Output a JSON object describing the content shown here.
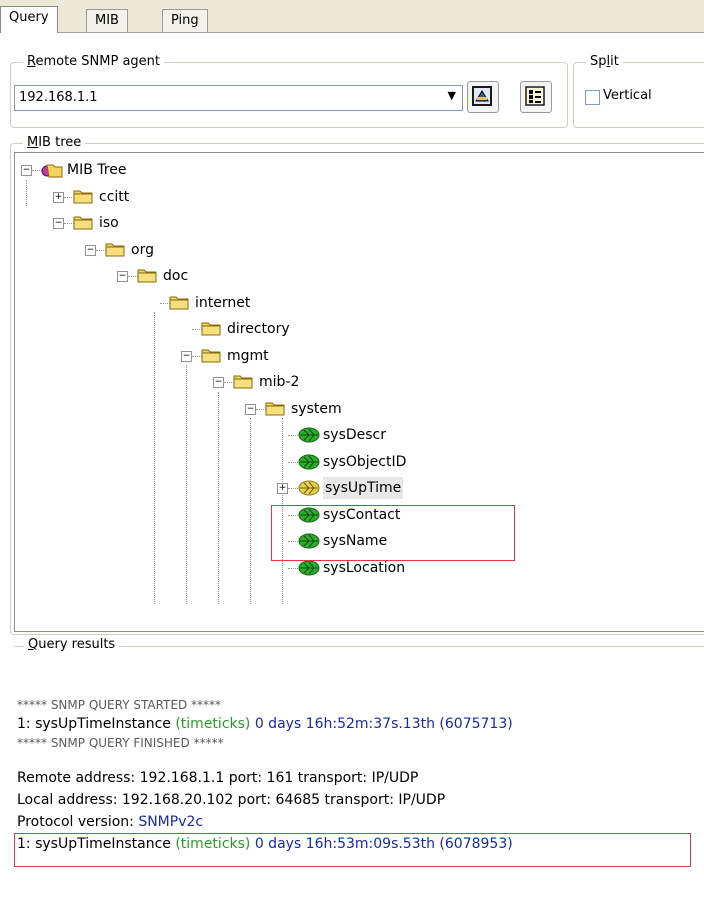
{
  "tabs": [
    "Query",
    "MIB",
    "Ping"
  ],
  "agent_group": {
    "legend_first": "R",
    "legend_rest": "emote SNMP agent"
  },
  "agent_input": {
    "value": "192.168.1.1",
    "arrow": "▼"
  },
  "split_group": {
    "legend_first": "Sp",
    "legend_u": "l",
    "legend_rest": "it",
    "checkbox_label": "Vertical"
  },
  "mib_group": {
    "legend_first": "M",
    "legend_rest": "IB tree"
  },
  "tree": [
    {
      "label": "MIB Tree",
      "icon": "mib-tree-icon",
      "expander": "−"
    },
    {
      "label": "ccitt",
      "icon": "folder-icon",
      "expander": "+"
    },
    {
      "label": "iso",
      "icon": "folder-icon",
      "expander": "−"
    },
    {
      "label": "org",
      "icon": "folder-icon",
      "expander": "−"
    },
    {
      "label": "doc",
      "icon": "folder-icon",
      "expander": "−"
    },
    {
      "label": "internet",
      "icon": "folder-icon",
      "expander": ""
    },
    {
      "label": "directory",
      "icon": "folder-icon",
      "expander": ""
    },
    {
      "label": "mgmt",
      "icon": "folder-icon",
      "expander": "−"
    },
    {
      "label": "mib-2",
      "icon": "folder-icon",
      "expander": "−"
    },
    {
      "label": "system",
      "icon": "folder-icon",
      "expander": "−"
    },
    {
      "label": "sysDescr",
      "icon": "leaf-icon",
      "expander": ""
    },
    {
      "label": "sysObjectID",
      "icon": "leaf-icon",
      "expander": ""
    },
    {
      "label": "sysUpTime",
      "icon": "leaf-selected-icon",
      "expander": "+"
    },
    {
      "label": "sysContact",
      "icon": "leaf-icon",
      "expander": ""
    },
    {
      "label": "sysName",
      "icon": "leaf-icon",
      "expander": ""
    },
    {
      "label": "sysLocation",
      "icon": "leaf-icon",
      "expander": ""
    }
  ],
  "results": {
    "legend_first": "Q",
    "legend_rest": "uery results",
    "started": "***** SNMP QUERY STARTED *****",
    "line1_prefix": "1: sysUpTimeInstance ",
    "line1_type": "(timeticks)",
    "line1_value": " 0 days 16h:52m:37s.13th (6075713)",
    "finished": "***** SNMP QUERY FINISHED *****",
    "remote": "Remote address: 192.168.1.1  port: 161 transport: IP/UDP",
    "local": "Local address: 192.168.20.102  port: 64685 transport: IP/UDP",
    "protocol_label": "Protocol version: ",
    "protocol_value": "SNMPv2c",
    "line2_prefix": "1: sysUpTimeInstance ",
    "line2_type": "(timeticks)",
    "line2_value": " 0 days 16h:53m:09s.53th (6078953)"
  },
  "colors": {
    "highlight": "#e0393e",
    "green": "#2a9a2a",
    "blue": "#1a2aa0"
  }
}
